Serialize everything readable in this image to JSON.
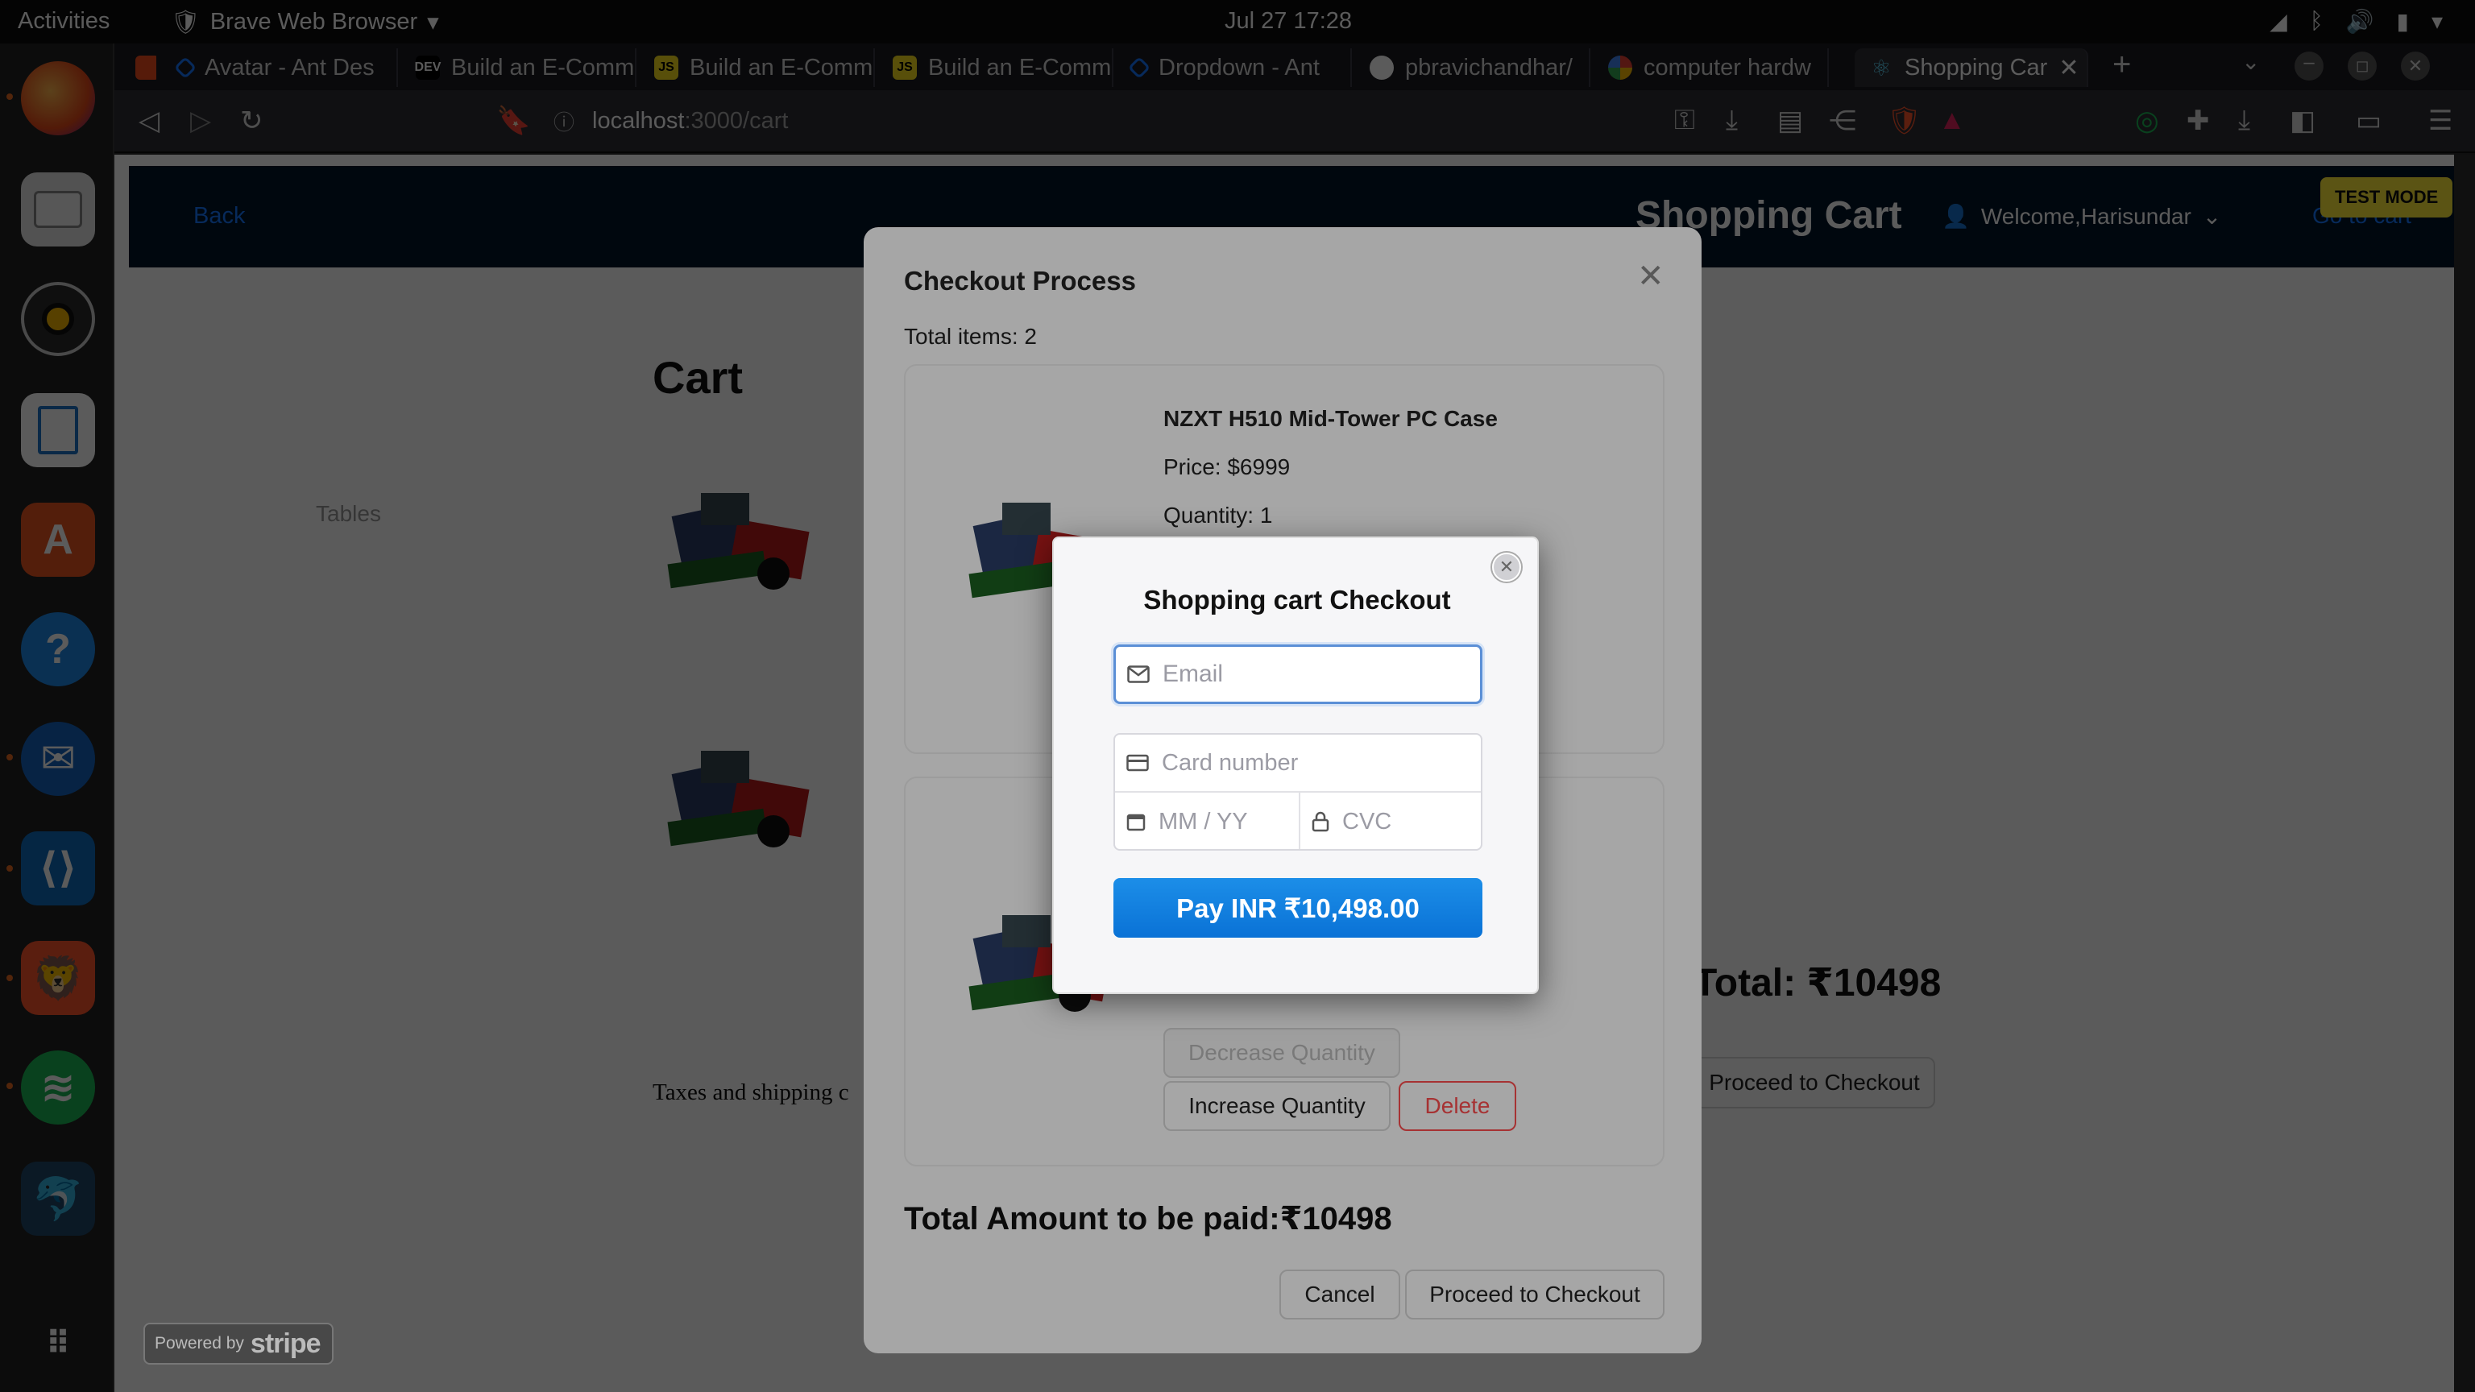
{
  "system": {
    "activities": "Activities",
    "app_name": "Brave Web Browser",
    "clock": "Jul 27  17:28"
  },
  "browser": {
    "tabs": [
      {
        "label": "Avatar - Ant Des",
        "favicon": "antd-icon"
      },
      {
        "label": "Build an E-Comm",
        "favicon": "dev-icon"
      },
      {
        "label": "Build an E-Comm",
        "favicon": "js-icon"
      },
      {
        "label": "Build an E-Comm",
        "favicon": "js-icon"
      },
      {
        "label": "Dropdown - Ant",
        "favicon": "antd-icon"
      },
      {
        "label": "pbravichandhar/",
        "favicon": "github-icon"
      },
      {
        "label": "computer hardw",
        "favicon": "google-icon"
      },
      {
        "label": "Shopping Car",
        "favicon": "react-icon",
        "active": true
      }
    ],
    "url_host": "localhost",
    "url_path": ":3000/cart"
  },
  "navbar": {
    "back": "Back",
    "brand": "Shopping Cart",
    "welcome": "Welcome,Harisundar",
    "go_cart": "Go to cart"
  },
  "badge": {
    "test_mode": "TEST MODE"
  },
  "cart_page": {
    "title": "Cart",
    "tables_label": "Tables",
    "taxes_text": "Taxes and shipping c",
    "total": "Total: ₹10498",
    "proceed": "Proceed to Checkout"
  },
  "checkout_modal": {
    "title": "Checkout Process",
    "total_items": "Total items: 2",
    "items": [
      {
        "name": "NZXT H510 Mid-Tower PC Case",
        "price": "Price: $6999",
        "quantity": "Quantity: 1"
      },
      {
        "name": "",
        "price": "",
        "quantity": ""
      }
    ],
    "decrease": "Decrease Quantity",
    "increase": "Increase Quantity",
    "delete": "Delete",
    "grand_total": "Total Amount to be paid:₹10498",
    "cancel": "Cancel",
    "proceed": "Proceed to Checkout"
  },
  "stripe": {
    "title": "Shopping cart Checkout",
    "email_placeholder": "Email",
    "card_placeholder": "Card number",
    "expiry_placeholder": "MM / YY",
    "cvc_placeholder": "CVC",
    "pay_label": "Pay INR ₹10,498.00",
    "powered_by": "Powered by",
    "stripe_word": "stripe"
  },
  "colors": {
    "accent": "#1677ff",
    "navbar": "#001529",
    "stripe_pay": "#0a72d6",
    "danger": "#ff4d4f",
    "test_mode": "#ffeb3b"
  }
}
